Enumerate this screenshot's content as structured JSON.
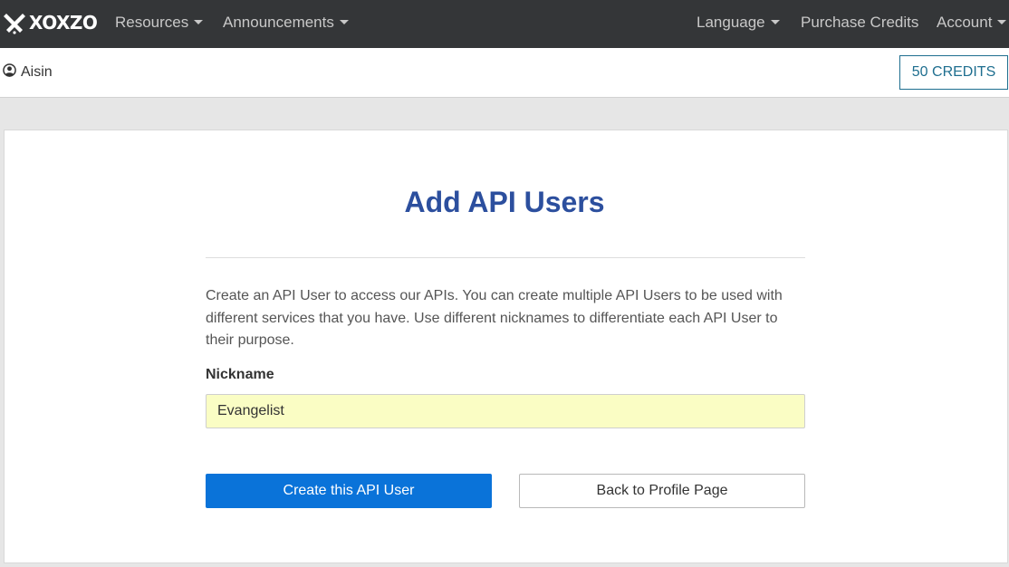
{
  "brand": {
    "name": "XOXZO"
  },
  "nav": {
    "resources": "Resources",
    "announcements": "Announcements",
    "language": "Language",
    "purchase_credits": "Purchase Credits",
    "account": "Account"
  },
  "subheader": {
    "user_name": "Aisin",
    "credits_label": "50 CREDITS"
  },
  "form": {
    "title": "Add API Users",
    "description": "Create an API User to access our APIs. You can create multiple API Users to be used with different services that you have. Use different nicknames to differentiate each API User to their purpose.",
    "nickname_label": "Nickname",
    "nickname_value": "Evangelist",
    "create_button": "Create this API User",
    "back_button": "Back to Profile Page"
  },
  "colors": {
    "navbar_bg": "#343638",
    "title": "#2c4f9e",
    "primary_button": "#0a73d9",
    "input_bg": "#fafdc4",
    "credits_border": "#1e6e8f"
  }
}
